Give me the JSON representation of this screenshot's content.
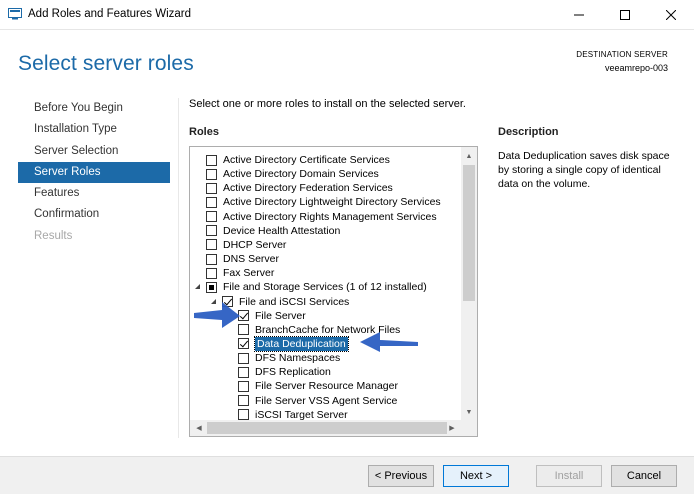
{
  "window": {
    "title": "Add Roles and Features Wizard"
  },
  "header": {
    "title": "Select server roles",
    "destination_label": "DESTINATION SERVER",
    "destination_value": "veeamrepo-003"
  },
  "nav": {
    "items": [
      {
        "label": "Before You Begin",
        "state": "normal"
      },
      {
        "label": "Installation Type",
        "state": "normal"
      },
      {
        "label": "Server Selection",
        "state": "normal"
      },
      {
        "label": "Server Roles",
        "state": "selected"
      },
      {
        "label": "Features",
        "state": "normal"
      },
      {
        "label": "Confirmation",
        "state": "normal"
      },
      {
        "label": "Results",
        "state": "disabled"
      }
    ]
  },
  "main": {
    "instruction": "Select one or more roles to install on the selected server.",
    "roles_heading": "Roles",
    "description_heading": "Description",
    "description_text": "Data Deduplication saves disk space by storing a single copy of identical data on the volume."
  },
  "roles": [
    {
      "label": "Active Directory Certificate Services",
      "state": "unchecked",
      "level": 0
    },
    {
      "label": "Active Directory Domain Services",
      "state": "unchecked",
      "level": 0
    },
    {
      "label": "Active Directory Federation Services",
      "state": "unchecked",
      "level": 0
    },
    {
      "label": "Active Directory Lightweight Directory Services",
      "state": "unchecked",
      "level": 0
    },
    {
      "label": "Active Directory Rights Management Services",
      "state": "unchecked",
      "level": 0
    },
    {
      "label": "Device Health Attestation",
      "state": "unchecked",
      "level": 0
    },
    {
      "label": "DHCP Server",
      "state": "unchecked",
      "level": 0
    },
    {
      "label": "DNS Server",
      "state": "unchecked",
      "level": 0
    },
    {
      "label": "Fax Server",
      "state": "unchecked",
      "level": 0
    },
    {
      "label": "File and Storage Services (1 of 12 installed)",
      "state": "partial",
      "level": 0,
      "expanded": true
    },
    {
      "label": "File and iSCSI Services",
      "state": "checked",
      "level": 1,
      "expanded": true
    },
    {
      "label": "File Server",
      "state": "checked",
      "level": 2
    },
    {
      "label": "BranchCache for Network Files",
      "state": "unchecked",
      "level": 2
    },
    {
      "label": "Data Deduplication",
      "state": "checked",
      "level": 2,
      "selected": true
    },
    {
      "label": "DFS Namespaces",
      "state": "unchecked",
      "level": 2
    },
    {
      "label": "DFS Replication",
      "state": "unchecked",
      "level": 2
    },
    {
      "label": "File Server Resource Manager",
      "state": "unchecked",
      "level": 2
    },
    {
      "label": "File Server VSS Agent Service",
      "state": "unchecked",
      "level": 2
    },
    {
      "label": "iSCSI Target Server",
      "state": "unchecked",
      "level": 2
    }
  ],
  "footer": {
    "previous_label": "< Previous",
    "next_label": "Next >",
    "install_label": "Install",
    "cancel_label": "Cancel"
  },
  "colors": {
    "accent": "#1c6aa8",
    "annotation_arrow": "#2b5ec2"
  }
}
